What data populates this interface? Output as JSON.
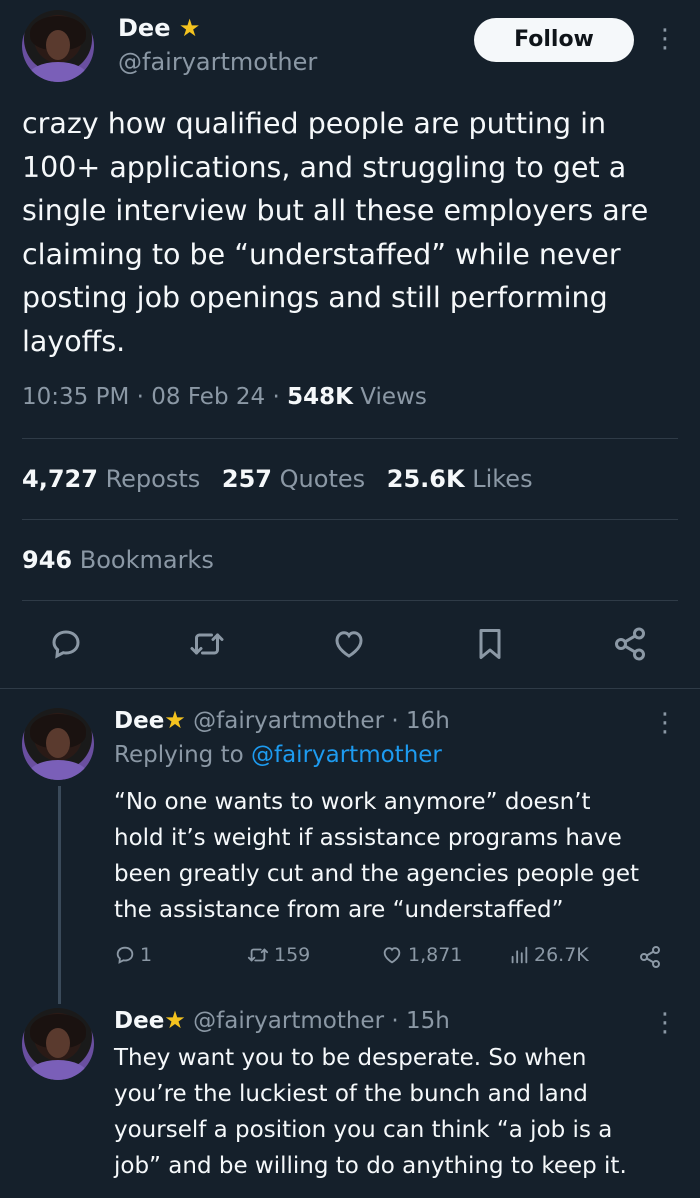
{
  "tweet": {
    "author_name": "Dee",
    "author_handle": "@fairyartmother",
    "follow_label": "Follow",
    "text": "crazy how qualified people are putting in\n100+ applications, and struggling to get a\nsingle interview but all these employers are\nclaiming to be “understaffed” while never\nposting job openings and still performing\nlayoffs.",
    "time": "10:35 PM",
    "date": "08 Feb 24",
    "views_count": "548K",
    "views_label": "Views",
    "reposts_count": "4,727",
    "reposts_label": "Reposts",
    "quotes_count": "257",
    "quotes_label": "Quotes",
    "likes_count": "25.6K",
    "likes_label": "Likes",
    "bookmarks_count": "946",
    "bookmarks_label": "Bookmarks",
    "actions": [
      "reply-icon",
      "repost-icon",
      "like-icon",
      "bookmark-icon",
      "share-icon"
    ]
  },
  "replies": [
    {
      "author_name": "Dee",
      "author_handle": "@fairyartmother",
      "age": "16h",
      "replying_prefix": "Replying to",
      "replying_to": "@fairyartmother",
      "text": "“No one wants to work anymore” doesn’t\nhold it’s weight if assistance programs have\nbeen greatly cut and the agencies people get\nthe assistance from are “understaffed”",
      "reply_count": "1",
      "repost_count": "159",
      "like_count": "1,871",
      "view_count": "26.7K"
    },
    {
      "author_name": "Dee",
      "author_handle": "@fairyartmother",
      "age": "15h",
      "text": "They want you to be desperate. So when\nyou’re the luckiest of the bunch and land\nyourself a position you can think “a job is a\njob” and be willing to do anything to keep it."
    }
  ],
  "colors": {
    "background": "#15202b",
    "text": "#f5f8fa",
    "muted": "#8b98a5",
    "link": "#1d9bf0",
    "star": "#f4c31f"
  }
}
